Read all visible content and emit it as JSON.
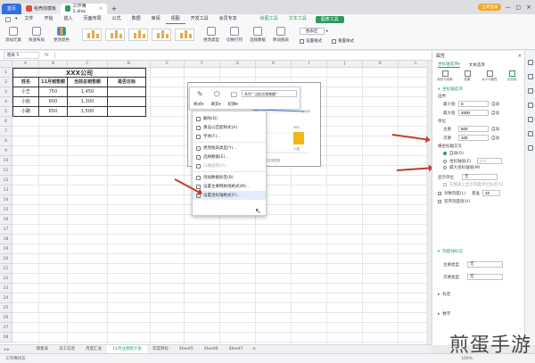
{
  "tabs": {
    "home": "首页",
    "doc1": "稻壳找模板",
    "doc2": "工作簿1.xlsx",
    "add": "+"
  },
  "window": {
    "login": "立即登录"
  },
  "menu": [
    "文件",
    "开始",
    "插入",
    "页面布局",
    "公式",
    "数据",
    "审阅",
    "视图",
    "开发工具",
    "会员专享"
  ],
  "menu_special": [
    "绘图工具",
    "文本工具"
  ],
  "menu_chip": "图表工具",
  "ribbon": {
    "add_element": "添加元素",
    "quick_layout": "快速布局",
    "change_color": "更改颜色",
    "change_type": "更改类型",
    "switch_rowcol": "切换行列",
    "select_data": "选择数据",
    "move_chart": "移动图表",
    "set_format": "设置格式",
    "reset_style": "重置样式",
    "chart_area": "图表区"
  },
  "formula": {
    "namebox": "图表 5",
    "fx": "fx"
  },
  "columns": [
    "A",
    "B",
    "C",
    "D",
    "E",
    "F",
    "G",
    "H",
    "I",
    "J",
    "K",
    "L",
    "M",
    "N",
    "O",
    "P",
    "Q"
  ],
  "rows": [
    "1",
    "2",
    "3",
    "4",
    "5",
    "6",
    "7",
    "8",
    "9",
    "10",
    "11",
    "12",
    "13",
    "14",
    "15",
    "16",
    "17",
    "18",
    "19",
    "20",
    "21",
    "22",
    "23",
    "24",
    "25",
    "26",
    "27",
    "28"
  ],
  "table": {
    "title": "XXX公司",
    "headers": [
      "姓名",
      "11月销售额",
      "当前总销售额",
      "是否达标"
    ],
    "data": [
      [
        "小王",
        "750",
        "1,450",
        ""
      ],
      [
        "小赵",
        "600",
        "1,300",
        ""
      ],
      [
        "小路",
        "650",
        "1,500",
        ""
      ]
    ]
  },
  "minitoolbar": {
    "style": "样式",
    "fill": "填充",
    "outline": "轮廓",
    "series": "系列 \"当前总销售额\""
  },
  "chart": {
    "val1": "1,650",
    "val2": "500",
    "legend1": "当前总销售额",
    "legend2": "小路"
  },
  "context_menu": [
    {
      "label": "删除(D)",
      "dim": false
    },
    {
      "label": "重设以匹配样式(A)",
      "dim": false
    },
    {
      "label": "字体(F)...",
      "dim": false
    },
    {
      "sep": true
    },
    {
      "label": "更改图表类型(Y)...",
      "dim": false
    },
    {
      "label": "选择数据(E)...",
      "dim": false
    },
    {
      "label": "三维旋转(V)...",
      "dim": true
    },
    {
      "sep": true
    },
    {
      "label": "添加数据标签(B)",
      "dim": false
    },
    {
      "label": "设置主要网格线格式(M)...",
      "dim": false
    },
    {
      "label": "设置坐标轴格式(F)...",
      "dim": false,
      "hl": true
    }
  ],
  "panel": {
    "title": "属性",
    "tab1": "坐标轴选项",
    "tab2": "文本选项",
    "subtabs": [
      "填充与线条",
      "效果",
      "大小与属性",
      "坐标轴"
    ],
    "section": "坐标轴选项",
    "bounds": "边界",
    "min_label": "最小值",
    "min_val": "0",
    "min_unit": "自动",
    "max_label": "最大值",
    "max_val": "2000",
    "max_unit": "自动",
    "units": "单位",
    "major_label": "主要",
    "major_val": "500",
    "major_unit": "自动",
    "minor_label": "次要",
    "minor_val": "100",
    "minor_unit": "自动",
    "cross": "横坐标轴交叉",
    "cross_opt1": "自动(O)",
    "cross_opt2": "坐标轴值(E)",
    "cross_val": "0.0",
    "cross_opt3": "最大坐标轴值(M)",
    "display_unit": "显示单位",
    "display_val": "无",
    "show_unit_label": "在图表上显示刻度单位标签(S)",
    "log": "对数刻度(L)",
    "log_base_label": "基准",
    "log_base": "10",
    "reverse": "逆序刻度值(V)",
    "tick_section": "刻度线标记",
    "major_type_label": "主要类型",
    "major_type": "无",
    "minor_type_label": "次要类型",
    "minor_type": "无",
    "labels": "标签",
    "number": "数字"
  },
  "sheet_tabs": [
    "销售表",
    "员工信息",
    "月度汇总",
    "11月业绩统计表",
    "年度目标",
    "Sheet5",
    "Sheet6",
    "Sheet7"
  ],
  "status": {
    "left": "工作簿状态",
    "zoom": "100%"
  },
  "watermark": "煎蛋手游",
  "colors": {
    "accent": "#2b9a5b",
    "home_tab": "#2f6fe0",
    "arrow": "#c23b2a",
    "bar": "#f2b619"
  }
}
